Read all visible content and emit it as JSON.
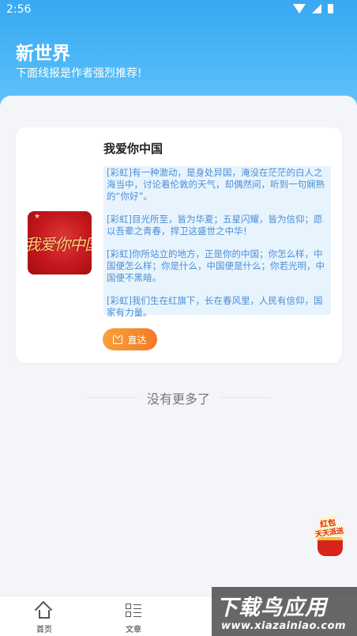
{
  "status_bar": {
    "time": "2:56"
  },
  "header": {
    "title": "新世界",
    "subtitle": "下面线报是作者强烈推荐!"
  },
  "card": {
    "title": "我爱你中国",
    "thumbnail_text": "我爱你中国",
    "quotes": [
      "[彩虹]有一种激动，是身处异国，淹没在茫茫的白人之海当中，讨论着伦敦的天气，却偶然间，听到一句娴熟的“你好”。",
      "[彩虹]目光所至，皆为华夏；五星闪耀，皆为信仰；愿以吾辈之青春，捍卫这盛世之中华！",
      "[彩虹]你所站立的地方，正是你的中国；你怎么样，中国便怎么样；你是什么，中国便是什么；你若光明，中国便不黑暗。",
      "[彩虹]我们生在红旗下，长在春风里，人民有信仰，国家有力量。"
    ],
    "button_label": "直达"
  },
  "list_end_text": "没有更多了",
  "floating_badge": {
    "line1": "红包",
    "line2": "天天派送"
  },
  "tabbar": [
    {
      "label": "首页",
      "icon": "home-icon"
    },
    {
      "label": "文章",
      "icon": "article-list-icon"
    }
  ],
  "watermark": {
    "title": "下载鸟应用",
    "url": "www.xiazainiao.com"
  },
  "colors": {
    "header_blue": "#38a8f2",
    "quote_text": "#4a8ed6",
    "quote_bg": "#e8f4fd",
    "button_orange": "#f57a28"
  }
}
